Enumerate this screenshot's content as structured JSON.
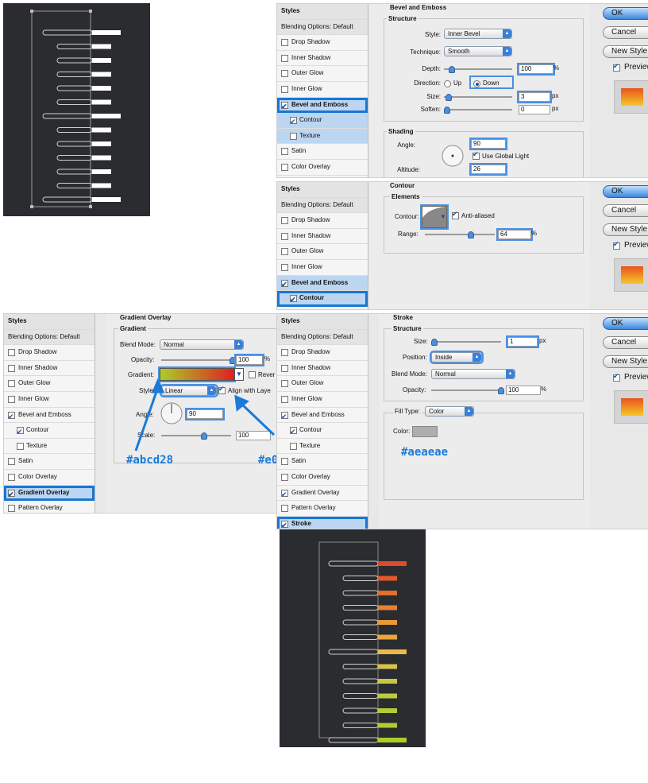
{
  "styles_list": {
    "header": "Styles",
    "blending": "Blending Options: Default",
    "items": [
      "Drop Shadow",
      "Inner Shadow",
      "Outer Glow",
      "Inner Glow",
      "Bevel and Emboss",
      "Contour",
      "Texture",
      "Satin",
      "Color Overlay",
      "Gradient Overlay",
      "Pattern Overlay",
      "Stroke"
    ]
  },
  "buttons": {
    "ok": "OK",
    "cancel": "Cancel",
    "new_style": "New Style",
    "preview": "Preview"
  },
  "bevel": {
    "title": "Bevel and Emboss",
    "structure": "Structure",
    "style_label": "Style:",
    "style_value": "Inner Bevel",
    "technique_label": "Technique:",
    "technique_value": "Smooth",
    "depth_label": "Depth:",
    "depth_value": "100",
    "depth_unit": "%",
    "direction_label": "Direction:",
    "up": "Up",
    "down": "Down",
    "size_label": "Size:",
    "size_value": "3",
    "size_unit": "px",
    "soften_label": "Soften:",
    "soften_value": "0",
    "soften_unit": "px",
    "shading": "Shading",
    "angle_label": "Angle:",
    "angle_value": "90",
    "global_light": "Use Global Light",
    "altitude_label": "Altitude:",
    "altitude_value": "26"
  },
  "contour": {
    "title": "Contour",
    "elements": "Elements",
    "contour_label": "Contour:",
    "anti_aliased": "Anti-aliased",
    "range_label": "Range:",
    "range_value": "64",
    "range_unit": "%"
  },
  "gradient": {
    "title": "Gradient Overlay",
    "group": "Gradient",
    "blend_label": "Blend Mode:",
    "blend_value": "Normal",
    "opacity_label": "Opacity:",
    "opacity_value": "100",
    "opacity_unit": "%",
    "gradient_label": "Gradient:",
    "reverse": "Rever",
    "style_label": "Style:",
    "style_value": "Linear",
    "align": "Align with Laye",
    "angle_label": "Angle:",
    "angle_value": "90",
    "scale_label": "Scale:",
    "scale_value": "100",
    "hex_left": "#abcd28",
    "hex_right": "#e0"
  },
  "stroke": {
    "title": "Stroke",
    "structure": "Structure",
    "size_label": "Size:",
    "size_value": "1",
    "size_unit": "px",
    "position_label": "Position:",
    "position_value": "Inside",
    "blend_label": "Blend Mode:",
    "blend_value": "Normal",
    "opacity_label": "Opacity:",
    "opacity_value": "100",
    "opacity_unit": "%",
    "filltype_label": "Fill Type:",
    "filltype_value": "Color",
    "color_label": "Color:",
    "hex": "#aeaeae"
  },
  "colors": {
    "accent": "#1877d4",
    "grad_start": "#abcd28",
    "grad_end": "#e02020",
    "stroke": "#aeaeae"
  }
}
